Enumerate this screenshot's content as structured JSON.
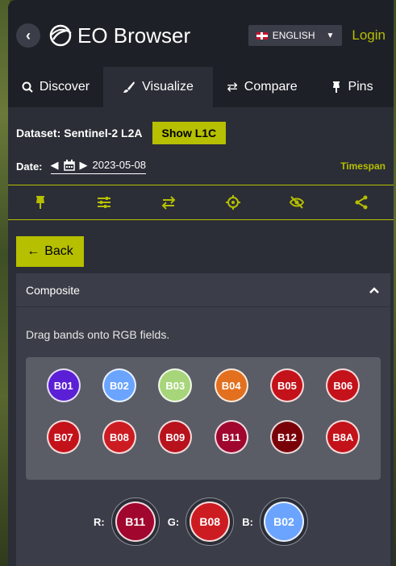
{
  "app": {
    "title": "EO Browser"
  },
  "header": {
    "language": "ENGLISH",
    "login": "Login"
  },
  "tabs": [
    {
      "label": "Discover",
      "icon": "search-icon"
    },
    {
      "label": "Visualize",
      "icon": "brush-icon"
    },
    {
      "label": "Compare",
      "icon": "swap-icon"
    },
    {
      "label": "Pins",
      "icon": "pin-icon"
    }
  ],
  "dataset": {
    "label": "Dataset:",
    "name": "Sentinel-2 L2A",
    "show_l1c": "Show L1C"
  },
  "date": {
    "label": "Date:",
    "value": "2023-05-08",
    "timespan": "Timespan"
  },
  "toolbar": {
    "icons": [
      "pin-icon",
      "sliders-icon",
      "swap-icon",
      "crosshair-icon",
      "eye-off-icon",
      "share-icon"
    ]
  },
  "back_label": "Back",
  "composite": {
    "title": "Composite",
    "hint": "Drag bands onto RGB fields.",
    "bands": [
      {
        "name": "B01",
        "color": "#5b1fd6"
      },
      {
        "name": "B02",
        "color": "#6aa4ff"
      },
      {
        "name": "B03",
        "color": "#a7d57a"
      },
      {
        "name": "B04",
        "color": "#e2701e"
      },
      {
        "name": "B05",
        "color": "#c4121a"
      },
      {
        "name": "B06",
        "color": "#c4121a"
      },
      {
        "name": "B07",
        "color": "#c4121a"
      },
      {
        "name": "B08",
        "color": "#cc1c22"
      },
      {
        "name": "B09",
        "color": "#b8121c"
      },
      {
        "name": "B11",
        "color": "#a0062e"
      },
      {
        "name": "B12",
        "color": "#7a0008"
      },
      {
        "name": "B8A",
        "color": "#c4121a"
      }
    ],
    "rgb": {
      "r_label": "R:",
      "g_label": "G:",
      "b_label": "B:",
      "r_band": "B11",
      "g_band": "B08",
      "b_band": "B02"
    }
  }
}
